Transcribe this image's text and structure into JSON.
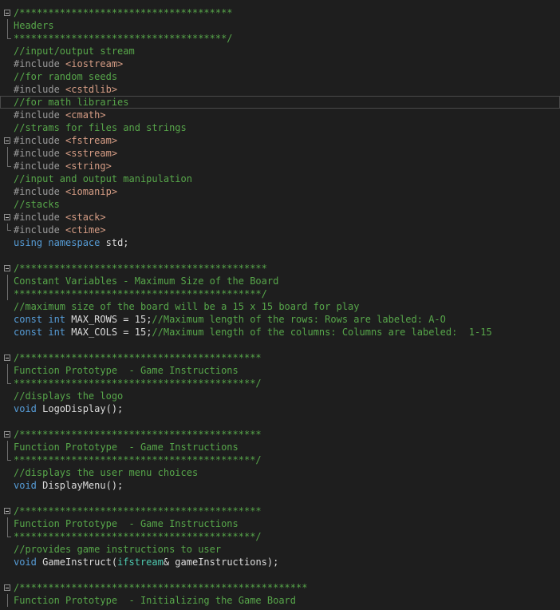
{
  "theme": {
    "background": "#1e1e1e",
    "comment_color": "#57a64a",
    "preprocessor_color": "#9b9b9b",
    "include_string_color": "#d69d85",
    "keyword_color": "#569cd6",
    "type_color": "#4ec9b0",
    "text_color": "#dcdcdc"
  },
  "current_line": 7,
  "lines": [
    {
      "fold": "start",
      "tokens": [
        {
          "t": "comment",
          "v": "/*************************************"
        }
      ]
    },
    {
      "fold": "mid",
      "tokens": [
        {
          "t": "comment",
          "v": "Headers"
        }
      ]
    },
    {
      "fold": "end",
      "tokens": [
        {
          "t": "comment",
          "v": "*************************************/"
        }
      ]
    },
    {
      "fold": "none",
      "tokens": [
        {
          "t": "comment",
          "v": "//input/output stream"
        }
      ]
    },
    {
      "fold": "none",
      "tokens": [
        {
          "t": "preproc",
          "v": "#include "
        },
        {
          "t": "string",
          "v": "<iostream>"
        }
      ]
    },
    {
      "fold": "none",
      "tokens": [
        {
          "t": "comment",
          "v": "//for random seeds"
        }
      ]
    },
    {
      "fold": "none",
      "tokens": [
        {
          "t": "preproc",
          "v": "#include "
        },
        {
          "t": "string",
          "v": "<cstdlib>"
        }
      ]
    },
    {
      "fold": "none",
      "tokens": [
        {
          "t": "comment",
          "v": "//for math libraries"
        }
      ]
    },
    {
      "fold": "none",
      "tokens": [
        {
          "t": "preproc",
          "v": "#include "
        },
        {
          "t": "string",
          "v": "<cmath>"
        }
      ]
    },
    {
      "fold": "none",
      "tokens": [
        {
          "t": "comment",
          "v": "//strams for files and strings"
        }
      ]
    },
    {
      "fold": "start",
      "tokens": [
        {
          "t": "preproc",
          "v": "#include "
        },
        {
          "t": "string",
          "v": "<fstream>"
        }
      ]
    },
    {
      "fold": "mid",
      "tokens": [
        {
          "t": "preproc",
          "v": "#include "
        },
        {
          "t": "string",
          "v": "<sstream>"
        }
      ]
    },
    {
      "fold": "end",
      "tokens": [
        {
          "t": "preproc",
          "v": "#include "
        },
        {
          "t": "string",
          "v": "<string>"
        }
      ]
    },
    {
      "fold": "none",
      "tokens": [
        {
          "t": "comment",
          "v": "//input and output manipulation"
        }
      ]
    },
    {
      "fold": "none",
      "tokens": [
        {
          "t": "preproc",
          "v": "#include "
        },
        {
          "t": "string",
          "v": "<iomanip>"
        }
      ]
    },
    {
      "fold": "none",
      "tokens": [
        {
          "t": "comment",
          "v": "//stacks"
        }
      ]
    },
    {
      "fold": "start",
      "tokens": [
        {
          "t": "preproc",
          "v": "#include "
        },
        {
          "t": "string",
          "v": "<stack>"
        }
      ]
    },
    {
      "fold": "end",
      "tokens": [
        {
          "t": "preproc",
          "v": "#include "
        },
        {
          "t": "string",
          "v": "<ctime>"
        }
      ]
    },
    {
      "fold": "none",
      "tokens": [
        {
          "t": "keyword",
          "v": "using"
        },
        {
          "t": "ident",
          "v": " "
        },
        {
          "t": "keyword",
          "v": "namespace"
        },
        {
          "t": "ident",
          "v": " std;"
        }
      ]
    },
    {
      "fold": "none",
      "tokens": []
    },
    {
      "fold": "start",
      "tokens": [
        {
          "t": "comment",
          "v": "/*******************************************"
        }
      ]
    },
    {
      "fold": "mid",
      "tokens": [
        {
          "t": "comment",
          "v": "Constant Variables - Maximum Size of the Board"
        }
      ]
    },
    {
      "fold": "mid",
      "tokens": [
        {
          "t": "comment",
          "v": "*******************************************/"
        }
      ]
    },
    {
      "fold": "none",
      "tokens": [
        {
          "t": "comment",
          "v": "//maximum size of the board will be a 15 x 15 board for play"
        }
      ]
    },
    {
      "fold": "none",
      "tokens": [
        {
          "t": "keyword",
          "v": "const"
        },
        {
          "t": "ident",
          "v": " "
        },
        {
          "t": "keyword",
          "v": "int"
        },
        {
          "t": "ident",
          "v": " MAX_ROWS = 15;"
        },
        {
          "t": "comment",
          "v": "//Maximum length of the rows: Rows are labeled: A-O"
        }
      ]
    },
    {
      "fold": "none",
      "tokens": [
        {
          "t": "keyword",
          "v": "const"
        },
        {
          "t": "ident",
          "v": " "
        },
        {
          "t": "keyword",
          "v": "int"
        },
        {
          "t": "ident",
          "v": " MAX_COLS = 15;"
        },
        {
          "t": "comment",
          "v": "//Maximum length of the columns: Columns are labeled:  1-15"
        }
      ]
    },
    {
      "fold": "none",
      "tokens": []
    },
    {
      "fold": "start",
      "tokens": [
        {
          "t": "comment",
          "v": "/******************************************"
        }
      ]
    },
    {
      "fold": "mid",
      "tokens": [
        {
          "t": "comment",
          "v": "Function Prototype  - Game Instructions"
        }
      ]
    },
    {
      "fold": "end",
      "tokens": [
        {
          "t": "comment",
          "v": "******************************************/"
        }
      ]
    },
    {
      "fold": "none",
      "tokens": [
        {
          "t": "comment",
          "v": "//displays the logo"
        }
      ]
    },
    {
      "fold": "none",
      "tokens": [
        {
          "t": "keyword",
          "v": "void"
        },
        {
          "t": "ident",
          "v": " LogoDisplay();"
        }
      ]
    },
    {
      "fold": "none",
      "tokens": []
    },
    {
      "fold": "start",
      "tokens": [
        {
          "t": "comment",
          "v": "/******************************************"
        }
      ]
    },
    {
      "fold": "mid",
      "tokens": [
        {
          "t": "comment",
          "v": "Function Prototype  - Game Instructions"
        }
      ]
    },
    {
      "fold": "end",
      "tokens": [
        {
          "t": "comment",
          "v": "******************************************/"
        }
      ]
    },
    {
      "fold": "none",
      "tokens": [
        {
          "t": "comment",
          "v": "//displays the user menu choices"
        }
      ]
    },
    {
      "fold": "none",
      "tokens": [
        {
          "t": "keyword",
          "v": "void"
        },
        {
          "t": "ident",
          "v": " DisplayMenu();"
        }
      ]
    },
    {
      "fold": "none",
      "tokens": []
    },
    {
      "fold": "start",
      "tokens": [
        {
          "t": "comment",
          "v": "/******************************************"
        }
      ]
    },
    {
      "fold": "mid",
      "tokens": [
        {
          "t": "comment",
          "v": "Function Prototype  - Game Instructions"
        }
      ]
    },
    {
      "fold": "end",
      "tokens": [
        {
          "t": "comment",
          "v": "******************************************/"
        }
      ]
    },
    {
      "fold": "none",
      "tokens": [
        {
          "t": "comment",
          "v": "//provides game instructions to user"
        }
      ]
    },
    {
      "fold": "none",
      "tokens": [
        {
          "t": "keyword",
          "v": "void"
        },
        {
          "t": "ident",
          "v": " GameInstruct("
        },
        {
          "t": "type",
          "v": "ifstream"
        },
        {
          "t": "ident",
          "v": "& gameInstructions);"
        }
      ]
    },
    {
      "fold": "none",
      "tokens": []
    },
    {
      "fold": "start",
      "tokens": [
        {
          "t": "comment",
          "v": "/**************************************************"
        }
      ]
    },
    {
      "fold": "mid",
      "tokens": [
        {
          "t": "comment",
          "v": "Function Prototype  - Initializing the Game Board"
        }
      ]
    }
  ]
}
